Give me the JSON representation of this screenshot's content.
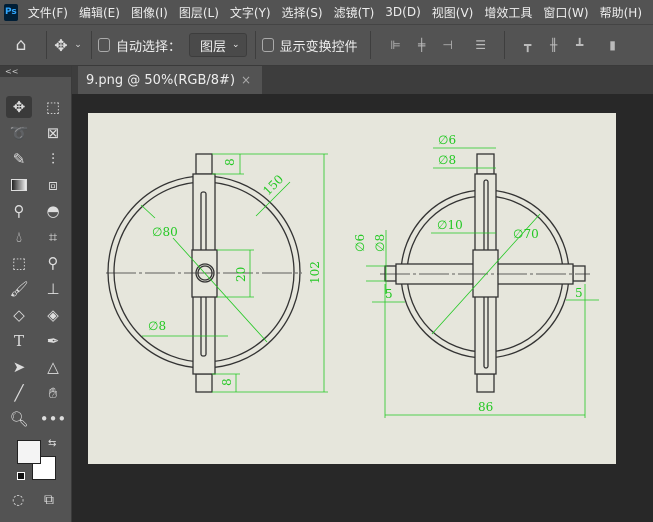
{
  "app": {
    "logo": "Ps"
  },
  "menu": [
    "文件(F)",
    "编辑(E)",
    "图像(I)",
    "图层(L)",
    "文字(Y)",
    "选择(S)",
    "滤镜(T)",
    "3D(D)",
    "视图(V)",
    "增效工具",
    "窗口(W)",
    "帮助(H)"
  ],
  "options": {
    "auto_select_label": "自动选择：",
    "auto_select_checked": false,
    "target_select": "图层",
    "show_transform_label": "显示变换控件",
    "show_transform_checked": false
  },
  "document_tab": {
    "title": "9.png @ 50%(RGB/8#)",
    "close": "×"
  },
  "toolbox": {
    "collapse": "<<",
    "tools": [
      "move",
      "marquee",
      "lasso",
      "frame",
      "quick-select",
      "slice",
      "gradient",
      "artboard",
      "eyedropper",
      "patch",
      "blur",
      "crop",
      "object-select",
      "color-sampler",
      "brush",
      "stamp",
      "eraser",
      "paint-bucket",
      "type",
      "pen",
      "path-select",
      "shape",
      "line",
      "hand",
      "zoom",
      "more"
    ],
    "foreground": "#f4f4f4",
    "background": "#ffffff"
  },
  "drawing": {
    "line_color": "#333333",
    "dim_color": "#22c822",
    "paper": "#e6e6dc",
    "left_view": {
      "dims": [
        "8",
        "150",
        "∅80",
        "20",
        "102",
        "∅8",
        "8"
      ]
    },
    "right_view": {
      "dims": [
        "∅6",
        "∅8",
        "∅10",
        "∅70",
        "∅6",
        "∅8",
        "5",
        "5",
        "86"
      ]
    }
  }
}
